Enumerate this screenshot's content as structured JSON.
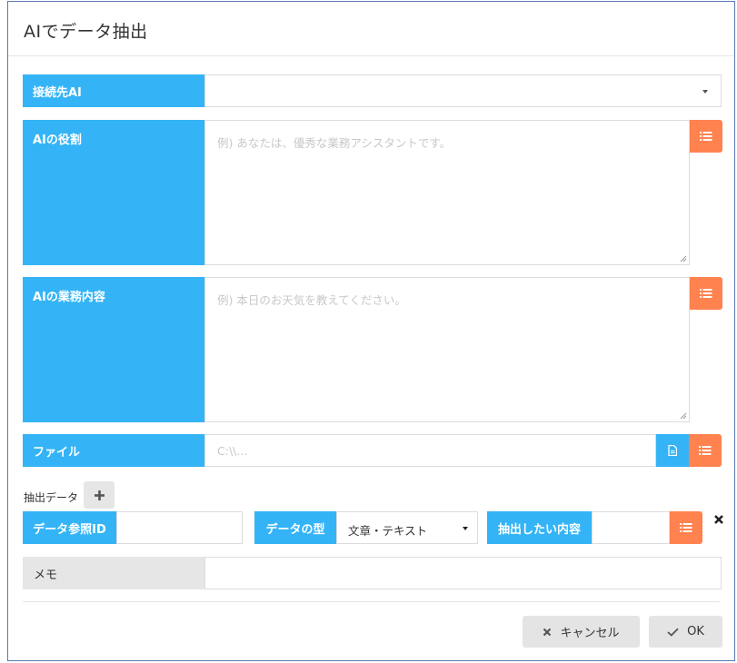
{
  "dialog": {
    "title": "AIでデータ抽出"
  },
  "ai_connection": {
    "label": "接続先AI",
    "value": ""
  },
  "ai_role": {
    "label": "AIの役割",
    "placeholder": "例) あなたは、優秀な業務アシスタントです。"
  },
  "ai_task": {
    "label": "AIの業務内容",
    "placeholder": "例) 本日のお天気を教えてください。"
  },
  "file": {
    "label": "ファイル",
    "placeholder": "C:\\\\..."
  },
  "extract": {
    "section_label": "抽出データ",
    "data_ref_id_label": "データ参照ID",
    "data_ref_id_value": "",
    "data_type_label": "データの型",
    "data_type_value": "文章・テキスト",
    "content_label": "抽出したい内容",
    "content_value": ""
  },
  "memo": {
    "label": "メモ",
    "value": ""
  },
  "footer": {
    "cancel_label": "キャンセル",
    "ok_label": "OK"
  },
  "colors": {
    "label_blue": "#34b4f6",
    "action_orange": "#ff824f",
    "neutral_button": "#e4e4e4",
    "border": "#5a79b6"
  },
  "icons": {
    "list": "list-icon",
    "file": "file-icon",
    "add": "plus-icon",
    "remove": "close-icon",
    "cancel": "x-icon",
    "ok": "check-icon"
  }
}
